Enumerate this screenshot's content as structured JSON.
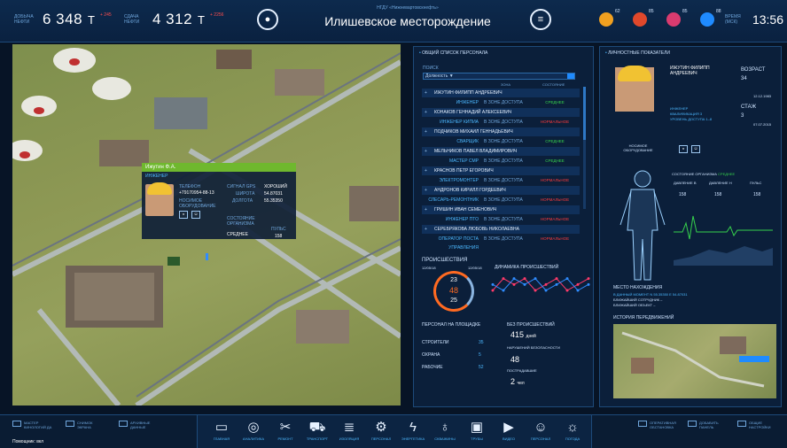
{
  "header": {
    "stat1": {
      "label": "ДОБЫЧА НЕФТИ",
      "value": "6 348",
      "unit": "Т",
      "delta": "+ 245"
    },
    "stat2": {
      "label": "СДАЧА НЕФТИ",
      "value": "4 312",
      "unit": "Т",
      "delta": "+ 2256"
    },
    "subtitle": "НГДУ «Нижневартовскнефть»",
    "title": "Илишевское месторождение",
    "alerts": [
      {
        "count": "62",
        "color": "#f0a020"
      },
      {
        "count": "85",
        "color": "#e0482b"
      },
      {
        "count": "85",
        "color": "#d93b6f"
      },
      {
        "count": "88",
        "color": "#1f8bff"
      }
    ],
    "time_label": "ВРЕМЯ (МСК)",
    "time": "13:56",
    "mic_icon": "microphone-icon",
    "menu_icon": "menu-icon"
  },
  "map_popup": {
    "name": "Ижутин Ф.А.",
    "role": "ИНЖЕНЕР",
    "phone_label": "ТЕЛЕФОН",
    "phone": "+79170954-88-13",
    "equipment_label": "НОСИМОЕ ОБОРУДОВАНИЕ",
    "gps_label": "СИГНАЛ GPS",
    "gps": "ХОРОШИЙ",
    "lat_label": "ШИРОТА",
    "lat": "54.87031",
    "lon_label": "ДОЛГОТА",
    "lon": "55.35350",
    "state_label": "СОСТОЯНИЕ ОРГАНИЗМА",
    "state": "СРЕДНЕЕ",
    "pulse_label": "ПУЛЬС",
    "pulse": "158"
  },
  "personnel": {
    "title": "ОБЩИЙ СПИСОК ПЕРСОНАЛА",
    "search_label": "ПОИСК",
    "search_value": "Должность ▼",
    "col_zone": "ЗОНА",
    "col_state": "СОСТОЯНИЕ",
    "rows": [
      {
        "name": "ИЖУТИН ФИЛИПП АНДРЕЕВИЧ",
        "role": "ИНЖЕНЕР",
        "zone": "В ЗОНЕ ДОСТУПА",
        "state": "СРЕДНЕЕ",
        "ok": true
      },
      {
        "name": "КОНАКОВ ГЕННАДИЙ АЛЕКСЕЕВИЧ",
        "role": "ИНЖЕНЕР КИПИА",
        "zone": "В ЗОНЕ ДОСТУПА",
        "state": "НОРМАЛЬНОЕ",
        "ok": false
      },
      {
        "name": "ПОДЧИКОВ МИХАИЛ ГЕННАДЬЕВИЧ",
        "role": "СВАРЩИК",
        "zone": "В ЗОНЕ ДОСТУПА",
        "state": "СРЕДНЕЕ",
        "ok": true
      },
      {
        "name": "МЕЛЬНИКОВ ПАВЕЛ ВЛАДИМИРОВИЧ",
        "role": "МАСТЕР СМР",
        "zone": "В ЗОНЕ ДОСТУПА",
        "state": "СРЕДНЕЕ",
        "ok": true
      },
      {
        "name": "КРАСНОВ ПЕТР ЕГОРОВИЧ",
        "role": "ЭЛЕКТРОМОНТЕР",
        "zone": "В ЗОНЕ ДОСТУПА",
        "state": "НОРМАЛЬНОЕ",
        "ok": false
      },
      {
        "name": "АНДРОНОВ КИРИЛЛ ГОРДЕЕВИЧ",
        "role": "СЛЕСАРЬ-РЕМОНТНИК",
        "zone": "В ЗОНЕ ДОСТУПА",
        "state": "НОРМАЛЬНОЕ",
        "ok": false
      },
      {
        "name": "ГРИШИН ИВАН СЕМЕНОВИЧ",
        "role": "ИНЖЕНЕР ПТО",
        "zone": "В ЗОНЕ ДОСТУПА",
        "state": "НОРМАЛЬНОЕ",
        "ok": false
      },
      {
        "name": "СЕРЕБРЯКОВА ЛЮБОВЬ НИКОЛАЕВНА",
        "role": "ОПЕРАТОР ПОСТА УПРАВЛЕНИЯ",
        "zone": "В ЗОНЕ ДОСТУПА",
        "state": "НОРМАЛЬНОЕ",
        "ok": false
      }
    ]
  },
  "incidents": {
    "title": "ПРОИСШЕСТВИЯ",
    "date_from": "12/05/18",
    "date_to": "12/05/18",
    "dynamics_title": "ДИНАМИКА ПРОИСШЕСТВИЙ",
    "gauge_values": [
      "23",
      "48",
      "25"
    ],
    "on_site_title": "ПЕРСОНАЛ НА ПЛОЩАДКЕ",
    "on_site": [
      {
        "label": "СТРОИТЕЛИ",
        "value": "35"
      },
      {
        "label": "ОХРАНА",
        "value": "5"
      },
      {
        "label": "РАБОЧИЕ",
        "value": "52"
      }
    ],
    "no_incidents_label": "БЕЗ ПРОИСШЕСТВИЙ",
    "no_incidents": "415",
    "no_incidents_unit": "дней",
    "violations_label": "НАРУШЕНИЙ БЕЗОПАСНОСТИ",
    "violations": "48",
    "injured_label": "ПОСТРАДАВШИЕ",
    "injured": "2",
    "injured_unit": "чел"
  },
  "personal": {
    "title": "ЛИЧНОСТНЫЕ ПОКАЗАТЕЛИ",
    "name": "ИЖУТИН ФИЛИПП АНДРЕЕВИЧ",
    "age_label": "ВОЗРАСТ",
    "age": "34",
    "role": "ИНЖЕНЕР",
    "qualification": "КВАЛИФИКАЦИЯ 3",
    "access": "УРОВЕНЬ ДОСТУПА 1–8",
    "exp_label": "СТАЖ",
    "exp": "3",
    "date1": "12.12.1983",
    "date2": "07.07.2015",
    "wearable": "НОСИМОЕ ОБОРУДОВАНИЕ",
    "body_title": "СОСТОЯНИЕ ОРГАНИЗМА",
    "body_state": "СРЕДНЕЕ",
    "pressure_up_label": "ДАВЛЕНИЕ В",
    "pressure_dn_label": "ДАВЛЕНИЕ Н",
    "pulse_label": "ПУЛЬС",
    "pressure_up": "158",
    "pressure_dn": "158",
    "pulse": "158",
    "location_title": "МЕСТО НАХОЖДЕНИЯ",
    "location_line": "В ДАННЫЙ МОМЕНТ N 55.35350 Е 54.87031",
    "nearest_staff": "БЛИЖАЙШИЙ СОТРУДНИК –",
    "nearest_obj": "БЛИЖАЙШИЙ ОБЪЕКТ –",
    "history_title": "ИСТОРИЯ ПЕРЕДВИЖЕНИЙ"
  },
  "footer": {
    "left": [
      {
        "label": "МАСТЕР КИНОЛОГИЙ ДА",
        "icon": "screen-icon"
      },
      {
        "label": "СНИМОК ЭКРАНА",
        "icon": "camera-icon"
      },
      {
        "label": "АРХИВНЫЕ ДАННЫЕ",
        "icon": "archive-icon"
      }
    ],
    "status": "Помощник: вкл",
    "nav": [
      {
        "label": "ГЛАВНАЯ",
        "icon": "▭",
        "name": "home-icon"
      },
      {
        "label": "АНАЛИТИКА",
        "icon": "◎",
        "name": "analytics-icon"
      },
      {
        "label": "РЕМОНТ",
        "icon": "✂",
        "name": "repair-icon"
      },
      {
        "label": "ТРАНСПОРТ",
        "icon": "⛟",
        "name": "transport-icon"
      },
      {
        "label": "ИЗОЛЯЦИЯ",
        "icon": "≣",
        "name": "isolation-icon"
      },
      {
        "label": "ПЕРСОНАЛ",
        "icon": "⚙",
        "name": "processes-icon"
      },
      {
        "label": "ЭНЕРГЕТИКА",
        "icon": "ϟ",
        "name": "energy-icon"
      },
      {
        "label": "СКВАЖИНЫ",
        "icon": "♁",
        "name": "wells-icon"
      },
      {
        "label": "ТРУБЫ",
        "icon": "▣",
        "name": "pipes-icon"
      },
      {
        "label": "ВИДЕО",
        "icon": "▶",
        "name": "video-icon"
      },
      {
        "label": "ПЕРСОНАЛ",
        "icon": "☺",
        "name": "personnel-icon"
      },
      {
        "label": "ПОГОДА",
        "icon": "☼",
        "name": "weather-icon"
      }
    ],
    "right": [
      {
        "label": "ОПЕРАТИВНАЯ ОБСТАНОВКА",
        "icon": "ops-icon"
      },
      {
        "label": "ДОБАВИТЬ ПАНЕЛЬ",
        "icon": "plus-icon"
      },
      {
        "label": "ОБЩИЕ НАСТРОЙКИ",
        "icon": "settings-icon"
      }
    ]
  },
  "chart_data": {
    "type": "line",
    "title": "ДИНАМИКА ПРОИСШЕСТВИЙ",
    "series": [
      {
        "color": "#ff3a6a",
        "values": [
          3,
          5,
          4,
          5,
          3,
          4,
          5,
          3,
          4,
          5
        ]
      },
      {
        "color": "#2f8cff",
        "values": [
          4,
          3,
          5,
          4,
          5,
          3,
          4,
          5,
          3,
          4
        ]
      }
    ]
  }
}
